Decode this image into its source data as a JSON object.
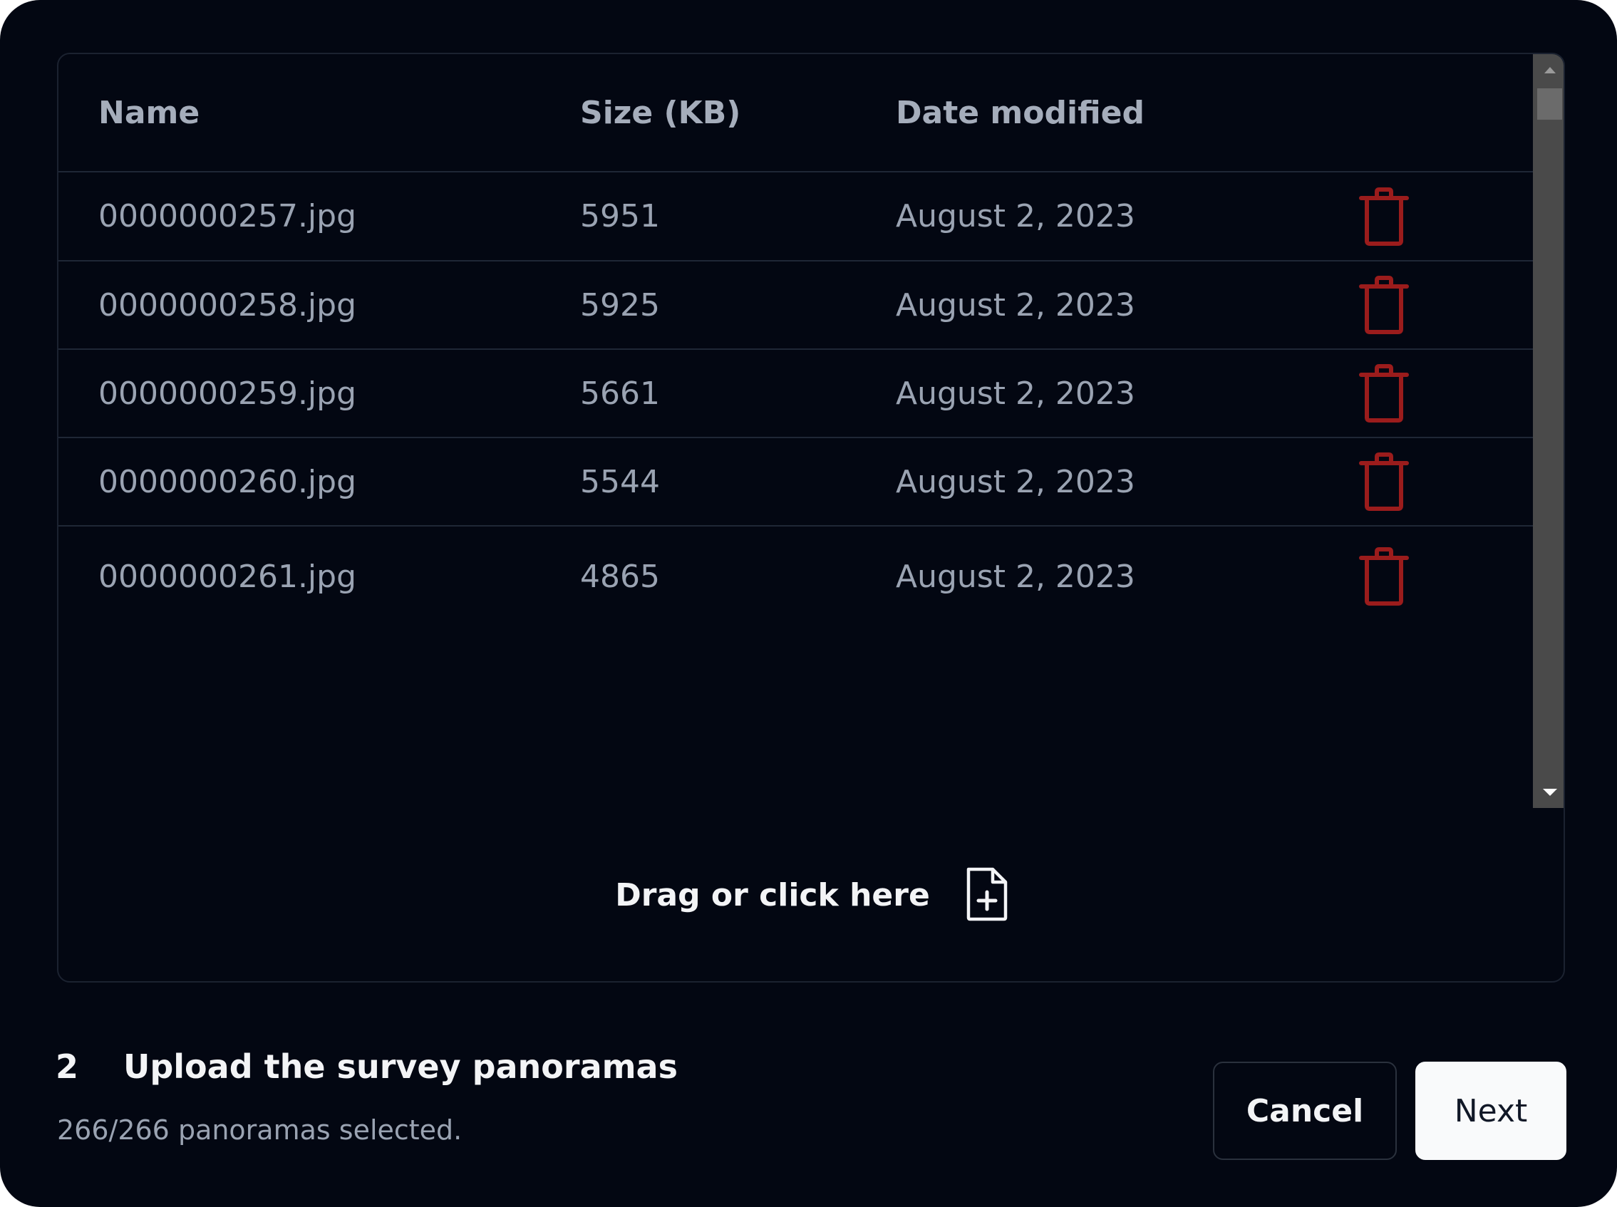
{
  "table": {
    "columns": [
      "Name",
      "Size (KB)",
      "Date modified"
    ],
    "rows": [
      {
        "name": "0000000257.jpg",
        "size": "5951",
        "date": "August 2, 2023"
      },
      {
        "name": "0000000258.jpg",
        "size": "5925",
        "date": "August 2, 2023"
      },
      {
        "name": "0000000259.jpg",
        "size": "5661",
        "date": "August 2, 2023"
      },
      {
        "name": "0000000260.jpg",
        "size": "5544",
        "date": "August 2, 2023"
      },
      {
        "name": "0000000261.jpg",
        "size": "4865",
        "date": "August 2, 2023"
      }
    ],
    "delete_icon": "trash-icon",
    "delete_color": "#9b1c1c"
  },
  "dropzone": {
    "label": "Drag or click here",
    "icon": "file-plus-icon"
  },
  "step": {
    "number": "2",
    "title": "Upload the survey panoramas",
    "status": "266/266 panoramas selected."
  },
  "buttons": {
    "cancel": "Cancel",
    "next": "Next"
  },
  "colors": {
    "background": "#030712",
    "text_muted": "#9aa3b2",
    "text_strong": "#f3f4f6",
    "next_bg": "#f9fafb"
  }
}
